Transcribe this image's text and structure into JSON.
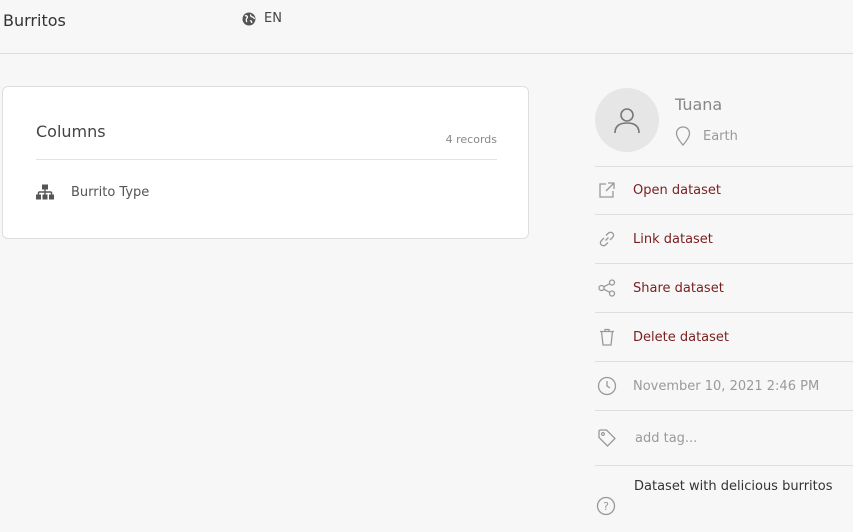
{
  "header": {
    "title": "Burritos",
    "language": "EN"
  },
  "columns_card": {
    "title": "Columns",
    "record_count": "4 records",
    "columns": [
      {
        "name": "Burrito Type"
      }
    ]
  },
  "profile": {
    "name": "Tuana",
    "location": "Earth"
  },
  "actions": {
    "open": "Open dataset",
    "link": "Link dataset",
    "share": "Share dataset",
    "delete": "Delete dataset"
  },
  "meta": {
    "timestamp": "November 10, 2021 2:46 PM",
    "tag_placeholder": "add tag...",
    "description": "Dataset with delicious burritos"
  },
  "colors": {
    "action_text": "#7a1f1f",
    "muted_text": "#9a9a9a",
    "background": "#f7f7f7"
  }
}
